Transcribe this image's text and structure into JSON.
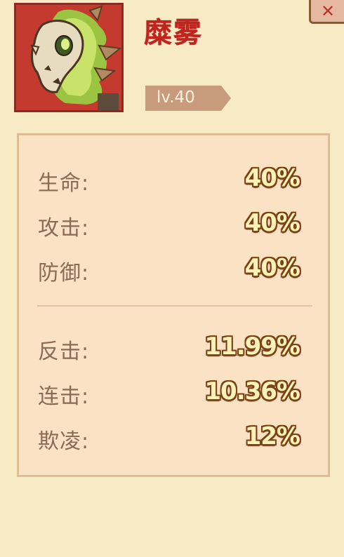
{
  "character": {
    "name": "糜雾",
    "level": "lv.40"
  },
  "stats_primary": [
    {
      "label": "生命:",
      "value": "40%"
    },
    {
      "label": "攻击:",
      "value": "40%"
    },
    {
      "label": "防御:",
      "value": "40%"
    }
  ],
  "stats_secondary": [
    {
      "label": "反击:",
      "value": "11.99%"
    },
    {
      "label": "连击:",
      "value": "10.36%"
    },
    {
      "label": "欺凌:",
      "value": "12%"
    }
  ],
  "icons": {
    "portrait": "skull-dragon-portrait",
    "close": "close-icon"
  },
  "colors": {
    "background": "#f7ebc6",
    "name": "#c4231d",
    "panel": "#fbe2c5",
    "portrait_bg": "#c43a2e"
  }
}
